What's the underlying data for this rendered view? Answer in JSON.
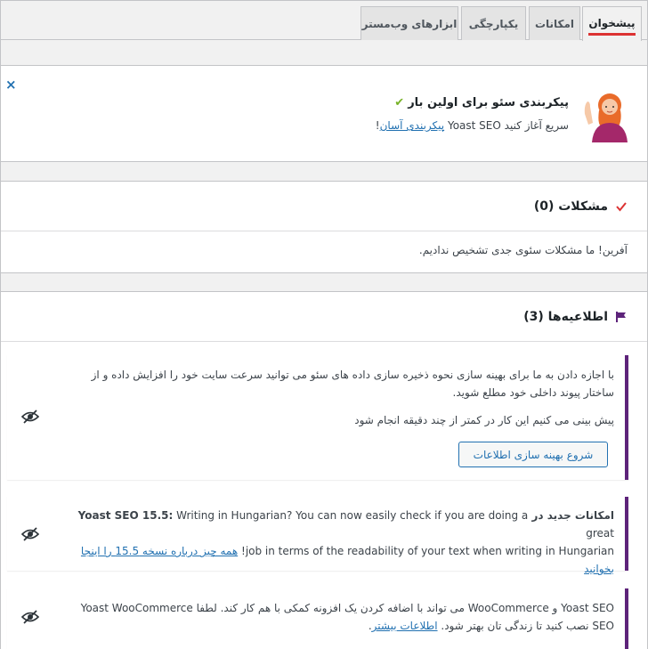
{
  "tabs": [
    {
      "label": "پیشخوان",
      "active": true
    },
    {
      "label": "امکانات"
    },
    {
      "label": "یکپارچگی"
    },
    {
      "label": "ابزارهای وب‌مستر"
    }
  ],
  "first_time": {
    "close_label": "×",
    "title": "پیکربندی سئو برای اولین بار",
    "subtitle_prefix": "سریع آغاز کنید Yoast SEO",
    "link_label": "پیکربندی آسان",
    "suffix": "!"
  },
  "problems": {
    "title": "مشکلات (0)",
    "message": "آفرین! ما مشکلات سئوی جدی تشخیص ندادیم."
  },
  "notifications": {
    "title": "اطلاعیه‌ها (3)",
    "items": [
      {
        "line1": "با اجازه دادن به ما برای بهینه سازی نحوه ذخیره سازی داده های سئو می توانید سرعت سایت خود را افزایش داده و از",
        "line2": "ساختار پیوند داخلی خود مطلع شوید.",
        "line3": "پیش بینی می کنیم این کار در کمتر از چند دقیقه انجام شود",
        "button": "شروع بهینه سازی اطلاعات"
      },
      {
        "bold_part": "امکانات جدید در Yoast SEO 15.5:",
        "text_part": "Writing in Hungarian? You can now easily check if you are doing a great",
        "line2": "job in terms of the readability of your text when writing in Hungarian!",
        "link_label_1": "همه چیز درباره نسخه 15.5 را اینجا",
        "link_label_2": "بخوانید"
      },
      {
        "line1": "Yoast SEO و WooCommerce می تواند با اضافه کردن یک افزونه کمکی با هم کار کند. لطفا Yoast WooCommerce",
        "line2": "SEO نصب کنید تا زندگی تان بهتر شود.",
        "link_label": "اطلاعات بیشتر",
        "suffix": "."
      }
    ]
  },
  "colors": {
    "accent_red": "#dc3232",
    "link_blue": "#2271b1",
    "yoast_purple": "#5d237a",
    "check_green": "#77b227"
  }
}
